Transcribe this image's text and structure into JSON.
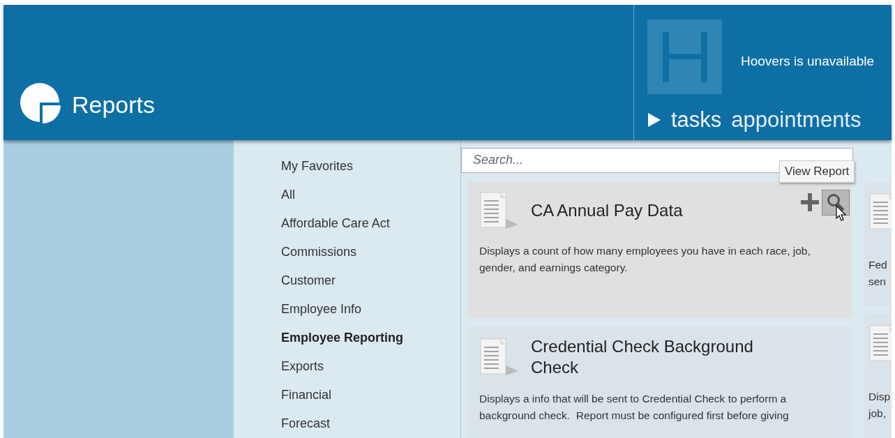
{
  "header": {
    "title": "Reports",
    "hoovers_message": "Hoovers is unavailable",
    "nav": [
      {
        "label": "tasks",
        "selected": true
      },
      {
        "label": "appointments",
        "selected": false
      }
    ]
  },
  "categories": [
    {
      "label": "My Favorites",
      "selected": false
    },
    {
      "label": "All",
      "selected": false
    },
    {
      "label": "Affordable Care Act",
      "selected": false
    },
    {
      "label": "Commissions",
      "selected": false
    },
    {
      "label": "Customer",
      "selected": false
    },
    {
      "label": "Employee Info",
      "selected": false
    },
    {
      "label": "Employee Reporting",
      "selected": true
    },
    {
      "label": "Exports",
      "selected": false
    },
    {
      "label": "Financial",
      "selected": false
    },
    {
      "label": "Forecast",
      "selected": false
    }
  ],
  "search": {
    "placeholder": "Search..."
  },
  "tooltip": "View Report",
  "reports": [
    {
      "title": "CA Annual Pay Data",
      "description": "Displays a count of how many employees you have in each race, job, gender, and earnings category.",
      "hovered": true
    },
    {
      "title": "Credential Check Background Check",
      "description": "Displays a info that will be sent to Credential Check to perform a background check.  Report must be configured first before giving",
      "hovered": false
    }
  ],
  "partial_reports": [
    {
      "description_lines": [
        "Fed",
        "sen"
      ]
    },
    {
      "description_lines": [
        "Disp",
        "job,"
      ]
    }
  ]
}
